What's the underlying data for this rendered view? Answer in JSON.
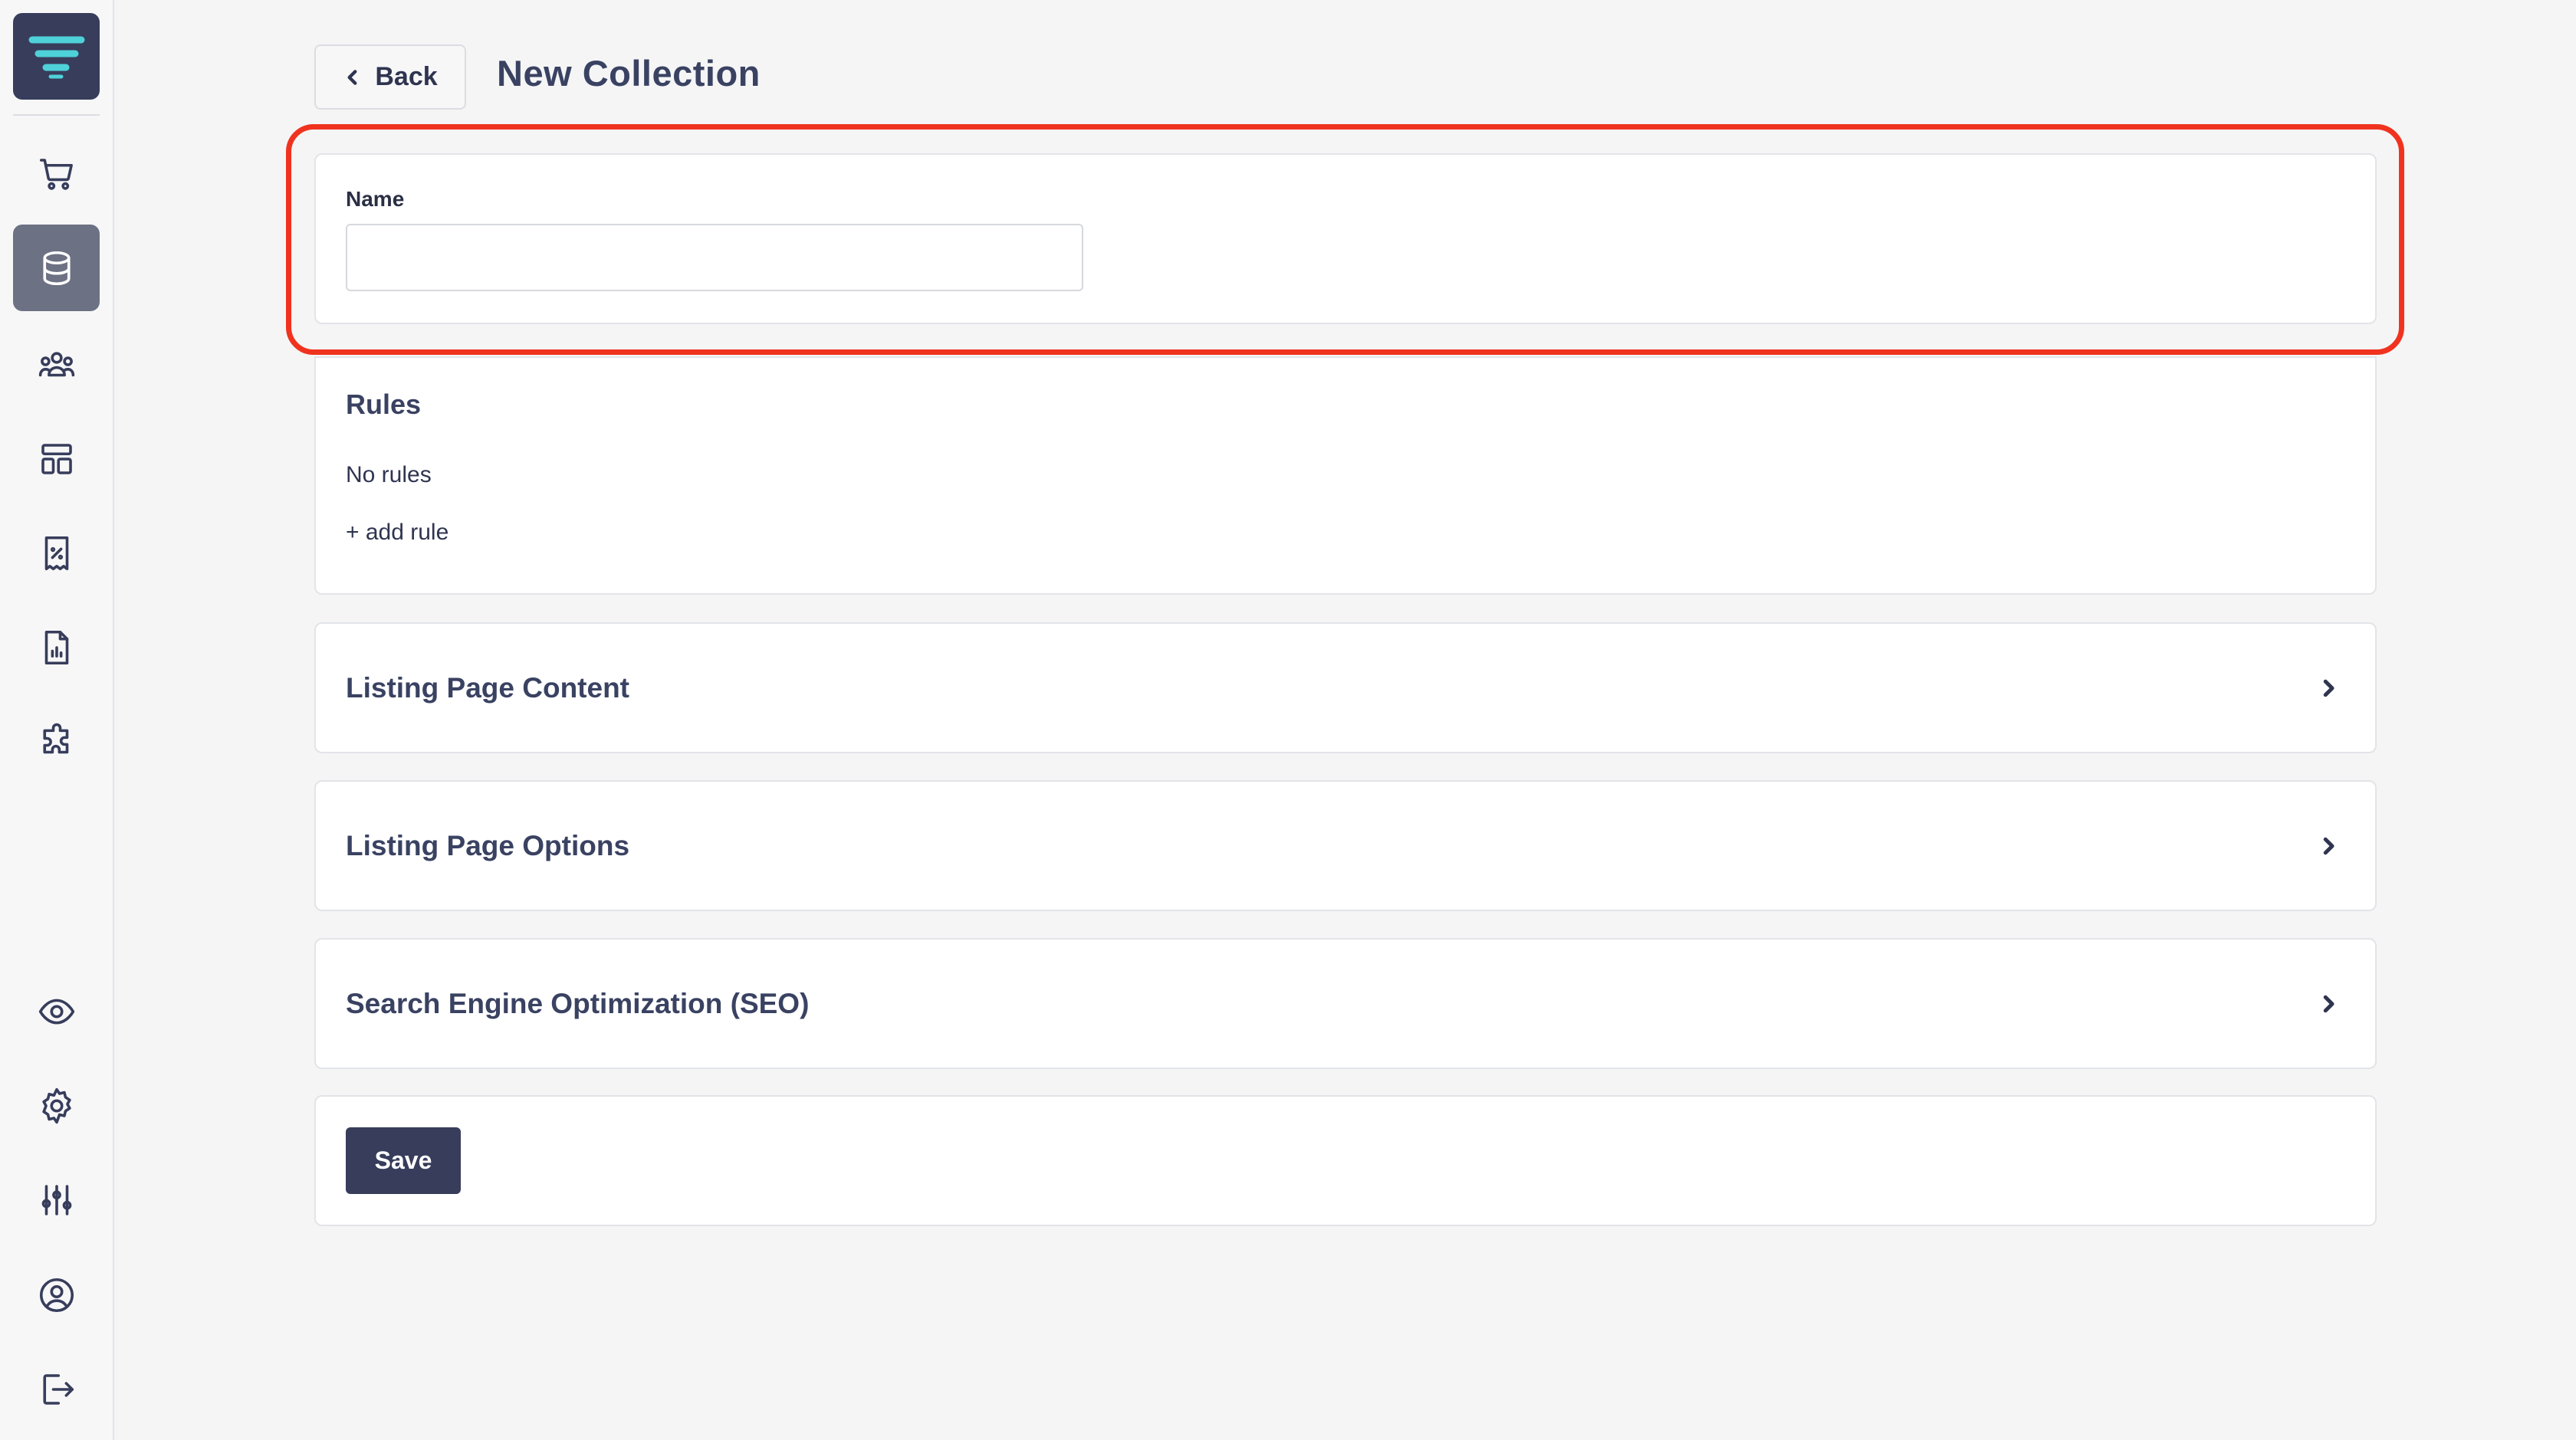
{
  "header": {
    "back_label": "Back",
    "title": "New Collection"
  },
  "sidebar": {
    "top_items": [
      {
        "icon": "shopping-cart-icon"
      },
      {
        "icon": "database-icon",
        "active": true
      },
      {
        "icon": "users-icon"
      },
      {
        "icon": "layout-icon"
      },
      {
        "icon": "receipt-percent-icon"
      },
      {
        "icon": "report-chart-icon"
      },
      {
        "icon": "puzzle-icon"
      }
    ],
    "bottom_items": [
      {
        "icon": "eye-icon"
      },
      {
        "icon": "gear-icon"
      },
      {
        "icon": "sliders-icon"
      },
      {
        "icon": "user-circle-icon"
      },
      {
        "icon": "logout-icon"
      }
    ]
  },
  "name_card": {
    "label": "Name",
    "value": "",
    "placeholder": ""
  },
  "rules_card": {
    "title": "Rules",
    "empty_text": "No rules",
    "add_label": "+ add rule"
  },
  "sections": [
    {
      "title": "Listing Page Content"
    },
    {
      "title": "Listing Page Options"
    },
    {
      "title": "Search Engine Optimization (SEO)"
    }
  ],
  "footer": {
    "save_label": "Save"
  },
  "colors": {
    "primary": "#373d5b",
    "highlight": "#f0331f",
    "background": "#f5f5f6"
  }
}
